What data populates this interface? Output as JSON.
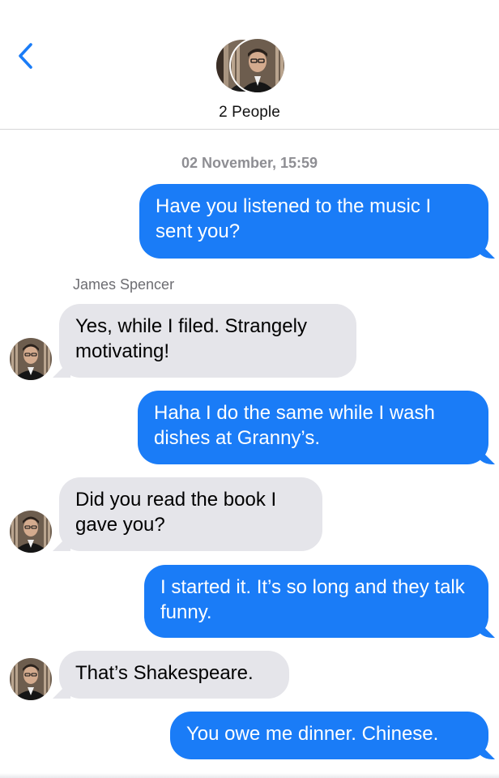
{
  "header": {
    "group_title": "2 People",
    "back_icon": "chevron-left-icon",
    "accent_color": "#1a7cf7"
  },
  "conversation": {
    "timestamp_date": "02 November,",
    "timestamp_time": "15:59",
    "sender_name": "James Spencer",
    "messages": [
      {
        "direction": "outgoing",
        "text": "Have you listened to the music I sent you?"
      },
      {
        "direction": "incoming",
        "sender": "James Spencer",
        "text": "Yes, while I filed. Strangely motivating!"
      },
      {
        "direction": "outgoing",
        "text": "Haha I do the same while I wash dishes at Granny’s."
      },
      {
        "direction": "incoming",
        "sender": "James Spencer",
        "text": "Did you read the book I gave you?"
      },
      {
        "direction": "outgoing",
        "text": "I started it. It’s so long and they talk funny."
      },
      {
        "direction": "incoming",
        "sender": "James Spencer",
        "text": "That’s Shakespeare."
      },
      {
        "direction": "outgoing",
        "text": "You owe me dinner. Chinese."
      }
    ]
  },
  "colors": {
    "outgoing_bubble": "#1a7cf7",
    "incoming_bubble": "#e5e5ea",
    "timestamp": "#8e8e93"
  }
}
